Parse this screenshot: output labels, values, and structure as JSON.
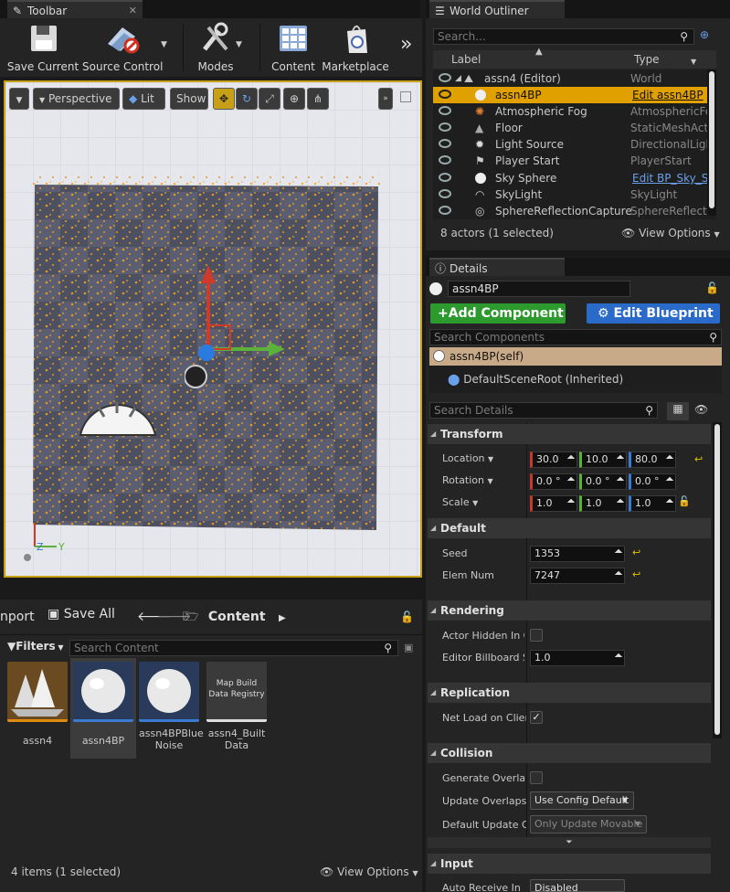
{
  "toolbar": {
    "tab_label": "Toolbar",
    "close": "✕",
    "buttons": [
      "Save Current",
      "Source Control",
      "Modes",
      "Content",
      "Marketplace"
    ],
    "more": "»"
  },
  "viewport": {
    "perspective": "Perspective",
    "lit": "Lit",
    "show": "Show",
    "axis_z": "Z",
    "axis_y": "Y"
  },
  "content_browser": {
    "import": "nport",
    "save_all": "Save All",
    "folder": "Content",
    "filters": "Filters",
    "search_placeholder": "Search Content",
    "assets": [
      {
        "name": "assn4",
        "accent": "#e08a10"
      },
      {
        "name": "assn4BP",
        "accent": "#3a7ad0"
      },
      {
        "name": "assn4BPBlue Noise",
        "accent": "#3a7ad0"
      },
      {
        "name": "assn4_Built Data",
        "thumb_text": "Map Build Data Registry",
        "accent": "#dddddd"
      }
    ],
    "status": "4 items (1 selected)",
    "view_options": "View Options"
  },
  "outliner": {
    "tab_label": "World Outliner",
    "search_placeholder": "Search...",
    "col_label": "Label",
    "col_type": "Type",
    "rows": [
      {
        "label": "assn4 (Editor)",
        "type": "World"
      },
      {
        "label": "assn4BP",
        "type": "Edit assn4BP"
      },
      {
        "label": "Atmospheric Fog",
        "type": "AtmosphericFo"
      },
      {
        "label": "Floor",
        "type": "StaticMeshActo"
      },
      {
        "label": "Light Source",
        "type": "DirectionalLigh"
      },
      {
        "label": "Player Start",
        "type": "PlayerStart"
      },
      {
        "label": "Sky Sphere",
        "type": "Edit BP_Sky_S"
      },
      {
        "label": "SkyLight",
        "type": "SkyLight"
      },
      {
        "label": "SphereReflectionCapture",
        "type": "SphereReflectio"
      }
    ],
    "status": "8 actors (1 selected)",
    "view_options": "View Options"
  },
  "details": {
    "tab_label": "Details",
    "name_value": "assn4BP",
    "add_component": "Add Component",
    "edit_blueprint": "Edit Blueprint",
    "search_components": "Search Components",
    "self_component": "assn4BP(self)",
    "root_component": "DefaultSceneRoot (Inherited)",
    "search_details": "Search Details",
    "sections": {
      "transform": "Transform",
      "default": "Default",
      "rendering": "Rendering",
      "replication": "Replication",
      "collision": "Collision",
      "input": "Input"
    },
    "location_label": "Location",
    "location": [
      "30.0",
      "10.0",
      "80.0"
    ],
    "rotation_label": "Rotation",
    "rotation": [
      "0.0 °",
      "0.0 °",
      "0.0 °"
    ],
    "scale_label": "Scale",
    "scale": [
      "1.0",
      "1.0",
      "1.0"
    ],
    "seed_label": "Seed",
    "seed": "1353",
    "elem_label": "Elem Num",
    "elem": "7247",
    "hidden_label": "Actor Hidden In Ga",
    "billboard_label": "Editor Billboard Sc",
    "billboard": "1.0",
    "net_load_label": "Net Load on Client",
    "gen_overlap_label": "Generate Overlap",
    "update_overlaps_label": "Update Overlaps M",
    "update_overlaps": "Use Config Default",
    "default_update_label": "Default Update Ov",
    "default_update": "Only Update Movable",
    "input_row_label": "Auto Receive In",
    "input_row_value": "Disabled"
  }
}
